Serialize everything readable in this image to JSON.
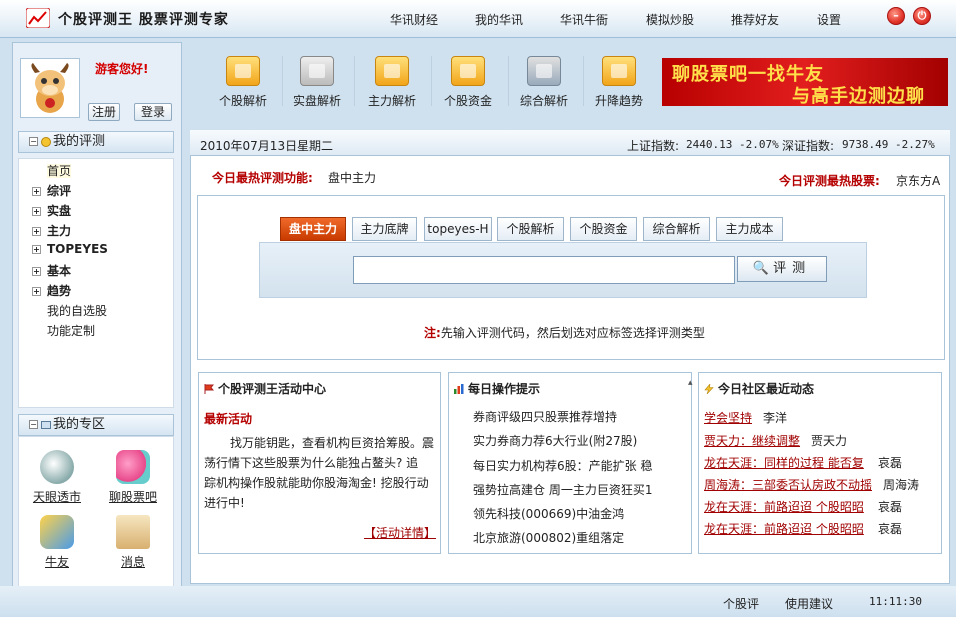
{
  "app": {
    "title": "个股评测王 股票评测专家"
  },
  "top_nav": [
    "华讯财经",
    "我的华讯",
    "华讯牛衙",
    "模拟炒股",
    "推荐好友",
    "设置"
  ],
  "user": {
    "greeting": "游客您好!",
    "register": "注册",
    "login": "登录"
  },
  "toolbar": [
    "个股解析",
    "实盘解析",
    "主力解析",
    "个股资金",
    "综合解析",
    "升降趋势"
  ],
  "banner": {
    "line1": "聊股票吧一找牛友",
    "line2": "与高手边测边聊"
  },
  "my_eval": {
    "title": "我的评测",
    "items": [
      {
        "label": "首页",
        "expand": ""
      },
      {
        "label": "综评",
        "expand": "+"
      },
      {
        "label": "实盘",
        "expand": "+"
      },
      {
        "label": "主力",
        "expand": "+"
      },
      {
        "label": "TOPEYES",
        "expand": "+"
      },
      {
        "label": "基本",
        "expand": "+"
      },
      {
        "label": "趋势",
        "expand": "+"
      },
      {
        "label": "我的自选股",
        "expand": ""
      },
      {
        "label": "功能定制",
        "expand": ""
      }
    ]
  },
  "my_zone": {
    "title": "我的专区",
    "items": [
      "天眼透市",
      "聊股票吧",
      "牛友",
      "消息"
    ]
  },
  "datebar": {
    "date": "2010年07月13日",
    "weekday": "星期二",
    "sh_label": "上证指数:",
    "sh_value": "2440.13 -2.07%",
    "sz_label": "深证指数:",
    "sz_value": "9738.49 -2.27%"
  },
  "hot": {
    "func_label": "今日最热评测功能:",
    "func_value": "盘中主力",
    "stock_label": "今日评测最热股票:",
    "stock_value": "京东方A"
  },
  "tabs": [
    "盘中主力",
    "主力底牌",
    "topeyes-H",
    "个股解析",
    "个股资金",
    "综合解析",
    "主力成本"
  ],
  "search": {
    "value": "",
    "button": "评测"
  },
  "note": {
    "prefix": "注:",
    "text": "先输入评测代码，然后划选对应标签选择评测类型"
  },
  "activity": {
    "title": "个股评测王活动中心",
    "subtitle": "最新活动",
    "lines": [
      "找万能钥匙，查看机构巨资拾筹股。震",
      "荡行情下这些股票为什么能独占鳌头? 追",
      "踪机构操作股就能助你股海淘金! 挖股行动",
      "进行中!"
    ],
    "more": "【活动详情】"
  },
  "tips": {
    "title": "每日操作提示",
    "items": [
      "券商评级四只股票推荐增持",
      "实力券商力荐6大行业(附27股)",
      "每日实力机构荐6股：产能扩张 稳",
      "强势拉高建仓 周一主力巨资狂买1",
      "领先科技(000669)中油金鸿",
      "北京旅游(000802)重组落定"
    ]
  },
  "community": {
    "title": "今日社区最近动态",
    "items": [
      {
        "topic": "学会坚持",
        "author": "李洋"
      },
      {
        "topic": "贾天力：继续调整",
        "author": "贾天力"
      },
      {
        "topic": "龙在天涯：同样的过程 能否复",
        "author": "哀磊"
      },
      {
        "topic": "周海涛：三部委否认房政不动摇",
        "author": "周海涛"
      },
      {
        "topic": "龙在天涯：前路迢迢 个股昭昭",
        "author": "哀磊"
      },
      {
        "topic": "龙在天涯：前路迢迢 个股昭昭",
        "author": "哀磊"
      }
    ]
  },
  "status": {
    "app": "个股评",
    "feedback": "使用建议",
    "time": "11:11:30"
  },
  "colors": {
    "accent_red": "#b50000",
    "tab_active": "#d84a0a",
    "panel_bg": "#e6eff7"
  }
}
